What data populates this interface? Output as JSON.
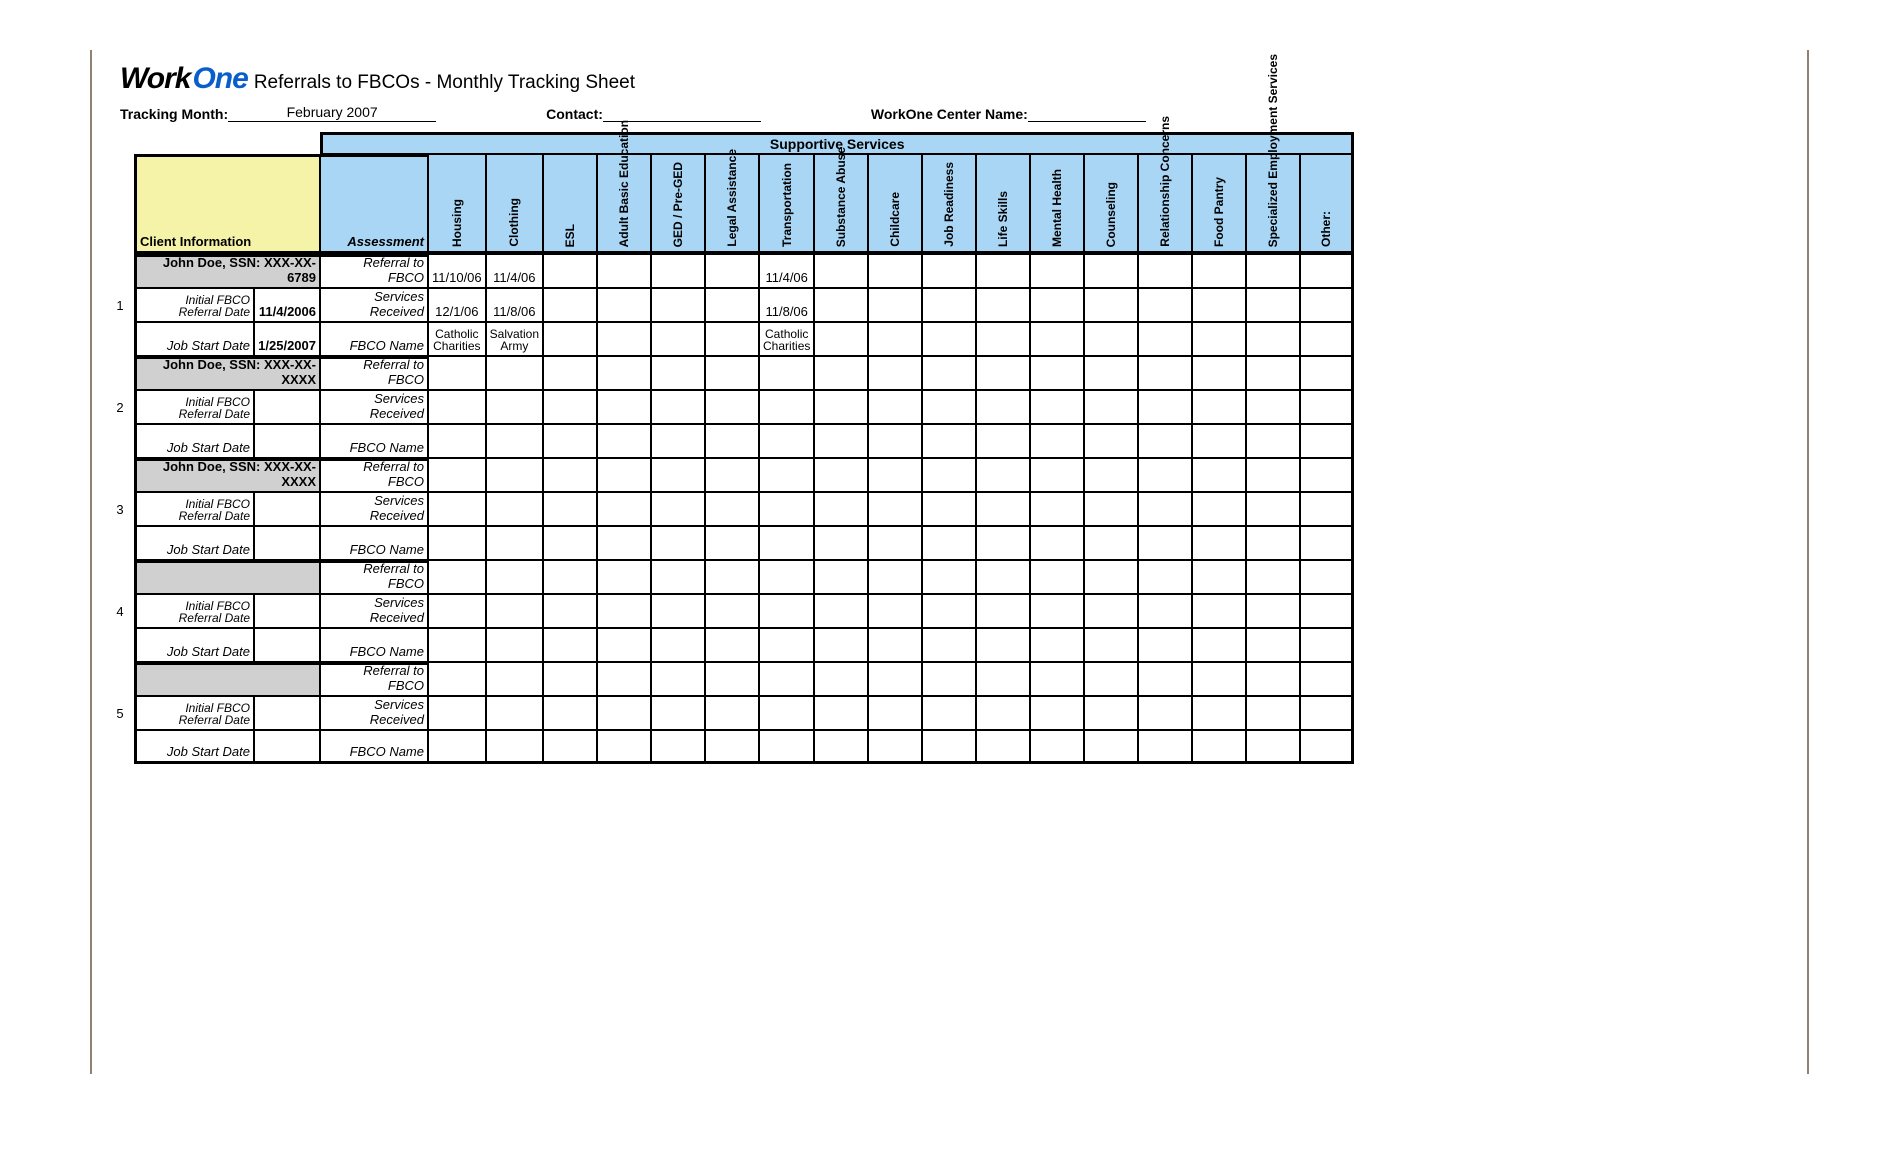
{
  "title": {
    "logo_work": "Work",
    "logo_one": "One",
    "subtitle": "Referrals to FBCOs - Monthly Tracking Sheet"
  },
  "meta": {
    "tracking_month_label": "Tracking Month:",
    "tracking_month_value": "February 2007",
    "contact_label": "Contact:",
    "contact_value": "",
    "center_label": "WorkOne Center Name:",
    "center_value": ""
  },
  "headers": {
    "supportive_services": "Supportive Services",
    "client_info": "Client Information",
    "assessment": "Assessment",
    "services": [
      "Housing",
      "Clothing",
      "ESL",
      "Adult Basic Education",
      "GED / Pre-GED",
      "Legal Assistance",
      "Transportation",
      "Substance Abuse",
      "Childcare",
      "Job Readiness",
      "Life Skills",
      "Mental Health",
      "Counseling",
      "Relationship Concerns",
      "Food Pantry",
      "Specialized Employment Services",
      "Other:"
    ]
  },
  "row_labels": {
    "initial_referral": "Initial FBCO Referral Date",
    "job_start": "Job Start Date",
    "referral_to_fbco": "Referral to FBCO",
    "services_received": "Services Received",
    "fbco_name": "FBCO Name"
  },
  "clients": [
    {
      "num": "1",
      "name_ssn": "John Doe, SSN: XXX-XX-6789",
      "referral_date": "11/4/2006",
      "job_start_date": "1/25/2007",
      "cells": {
        "referral": {
          "0": "11/10/06",
          "1": "11/4/06",
          "6": "11/4/06"
        },
        "services": {
          "0": "12/1/06",
          "1": "11/8/06",
          "6": "11/8/06"
        },
        "fbco": {
          "0": "Catholic Charities",
          "1": "Salvation Army",
          "6": "Catholic Charities"
        }
      }
    },
    {
      "num": "2",
      "name_ssn": "John Doe, SSN: XXX-XX-XXXX",
      "referral_date": "",
      "job_start_date": "",
      "cells": {
        "referral": {},
        "services": {},
        "fbco": {}
      }
    },
    {
      "num": "3",
      "name_ssn": "John Doe, SSN: XXX-XX-XXXX",
      "referral_date": "",
      "job_start_date": "",
      "cells": {
        "referral": {},
        "services": {},
        "fbco": {}
      }
    },
    {
      "num": "4",
      "name_ssn": "",
      "referral_date": "",
      "job_start_date": "",
      "cells": {
        "referral": {},
        "services": {},
        "fbco": {}
      }
    },
    {
      "num": "5",
      "name_ssn": "",
      "referral_date": "",
      "job_start_date": "",
      "cells": {
        "referral": {},
        "services": {},
        "fbco": {}
      }
    }
  ]
}
